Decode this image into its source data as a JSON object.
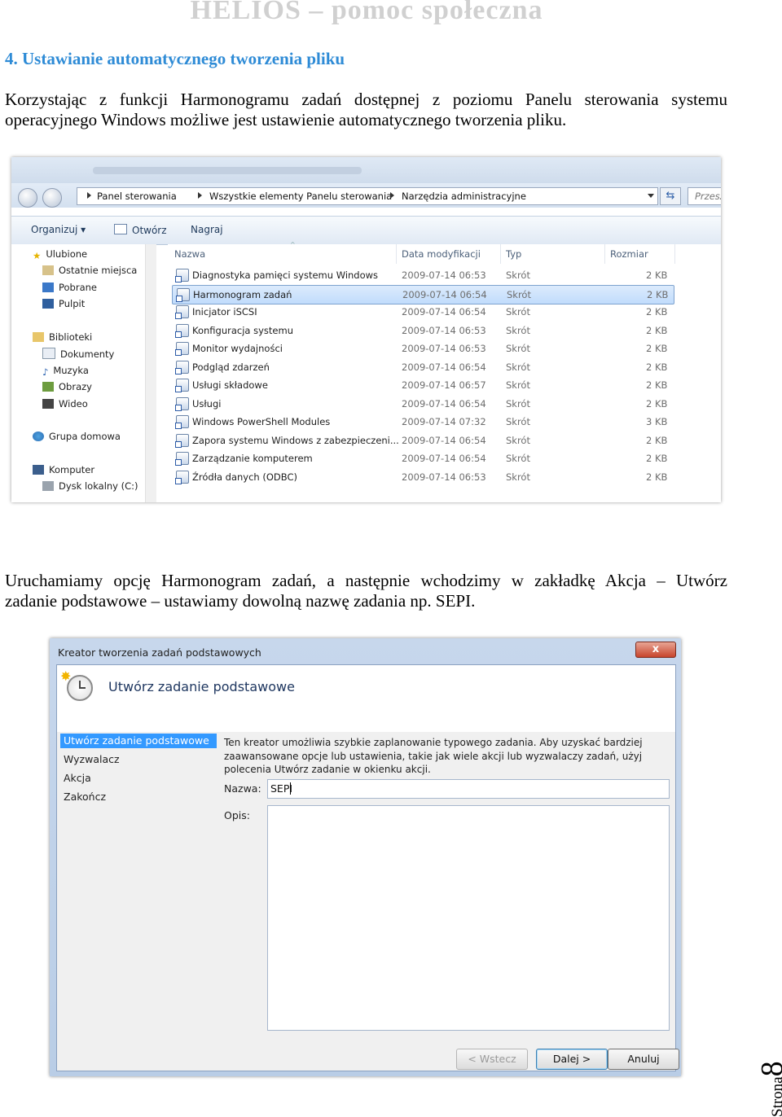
{
  "header": {
    "title": "HELIOS – pomoc społeczna"
  },
  "section": {
    "heading": "4. Ustawianie automatycznego tworzenia pliku"
  },
  "paragraph1": {
    "line1": "Korzystając z funkcji Harmonogramu zadań dostępnej z poziomu Panelu sterowania systemu",
    "line2": "operacyjnego Windows możliwe jest ustawienie automatycznego tworzenia pliku."
  },
  "explorer": {
    "breadcrumbs": [
      "Panel sterowania",
      "Wszystkie elementy Panelu sterowania",
      "Narzędzia administracyjne"
    ],
    "search_placeholder": "Przesz",
    "toolbar": {
      "organize": "Organizuj ▾",
      "open": "Otwórz",
      "record": "Nagraj"
    },
    "nav": {
      "favorites": "Ulubione",
      "recent": "Ostatnie miejsca",
      "downloads": "Pobrane",
      "desktop": "Pulpit",
      "libraries": "Biblioteki",
      "documents": "Dokumenty",
      "music": "Muzyka",
      "pictures": "Obrazy",
      "videos": "Wideo",
      "homegroup": "Grupa domowa",
      "computer": "Komputer",
      "local_disk": "Dysk lokalny (C:)"
    },
    "columns": {
      "name": "Nazwa",
      "date": "Data modyfikacji",
      "type": "Typ",
      "size": "Rozmiar"
    },
    "files": [
      {
        "name": "Diagnostyka pamięci systemu Windows",
        "date": "2009-07-14 06:53",
        "type": "Skrót",
        "size": "2 KB"
      },
      {
        "name": "Harmonogram zadań",
        "date": "2009-07-14 06:54",
        "type": "Skrót",
        "size": "2 KB"
      },
      {
        "name": "Inicjator iSCSI",
        "date": "2009-07-14 06:54",
        "type": "Skrót",
        "size": "2 KB"
      },
      {
        "name": "Konfiguracja systemu",
        "date": "2009-07-14 06:53",
        "type": "Skrót",
        "size": "2 KB"
      },
      {
        "name": "Monitor wydajności",
        "date": "2009-07-14 06:53",
        "type": "Skrót",
        "size": "2 KB"
      },
      {
        "name": "Podgląd zdarzeń",
        "date": "2009-07-14 06:54",
        "type": "Skrót",
        "size": "2 KB"
      },
      {
        "name": "Usługi składowe",
        "date": "2009-07-14 06:57",
        "type": "Skrót",
        "size": "2 KB"
      },
      {
        "name": "Usługi",
        "date": "2009-07-14 06:54",
        "type": "Skrót",
        "size": "2 KB"
      },
      {
        "name": "Windows PowerShell Modules",
        "date": "2009-07-14 07:32",
        "type": "Skrót",
        "size": "3 KB"
      },
      {
        "name": "Zapora systemu Windows z zabezpieczeni...",
        "date": "2009-07-14 06:54",
        "type": "Skrót",
        "size": "2 KB"
      },
      {
        "name": "Zarządzanie komputerem",
        "date": "2009-07-14 06:54",
        "type": "Skrót",
        "size": "2 KB"
      },
      {
        "name": "Źródła danych (ODBC)",
        "date": "2009-07-14 06:53",
        "type": "Skrót",
        "size": "2 KB"
      }
    ]
  },
  "paragraph2": {
    "line1": "Uruchamiamy opcję Harmonogram zadań, a następnie wchodzimy w zakładkę Akcja – Utwórz",
    "line2": "zadanie podstawowe – ustawiamy dowolną nazwę zadania np. SEPI."
  },
  "wizard": {
    "window_title": "Kreator tworzenia zadań podstawowych",
    "close_glyph": "x",
    "heading": "Utwórz zadanie podstawowe",
    "steps": [
      "Utwórz zadanie podstawowe",
      "Wyzwalacz",
      "Akcja",
      "Zakończ"
    ],
    "description": "Ten kreator umożliwia szybkie zaplanowanie typowego zadania. Aby uzyskać bardziej zaawansowane opcje lub ustawienia, takie jak wiele akcji lub wyzwalaczy zadań, użyj polecenia Utwórz zadanie w okienku akcji.",
    "name_label": "Nazwa:",
    "name_value": "SEPI",
    "desc_label": "Opis:",
    "buttons": {
      "back": "< Wstecz",
      "next": "Dalej >",
      "cancel": "Anuluj"
    }
  },
  "footer": {
    "page_word": "Strona",
    "page_number": "8"
  }
}
